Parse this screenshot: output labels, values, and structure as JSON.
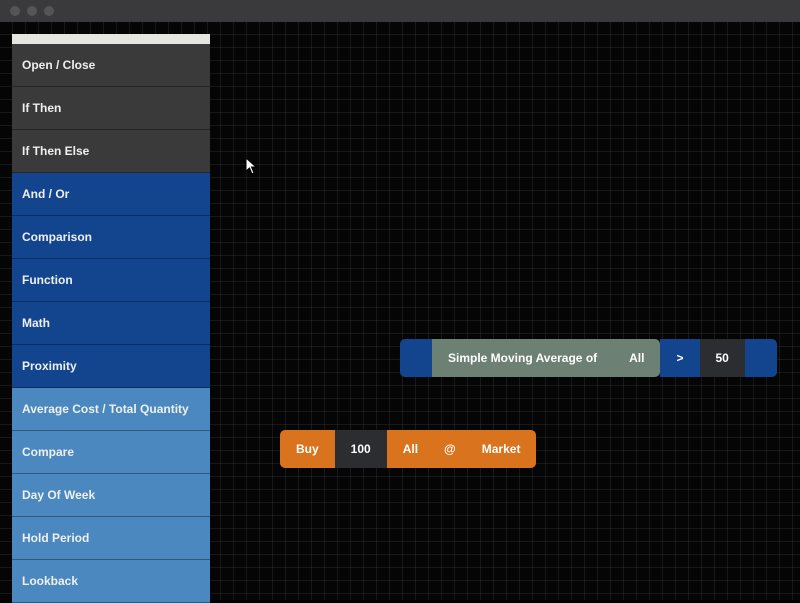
{
  "sidebar": {
    "groups": [
      {
        "tone": "dark",
        "items": [
          "Open / Close",
          "If Then",
          "If Then Else"
        ]
      },
      {
        "tone": "blue",
        "items": [
          "And / Or",
          "Comparison",
          "Function",
          "Math",
          "Proximity"
        ]
      },
      {
        "tone": "lightblue",
        "items": [
          "Average Cost / Total Quantity",
          "Compare",
          "Day Of Week",
          "Hold Period",
          "Lookback"
        ]
      }
    ]
  },
  "canvas": {
    "comparison_node": {
      "function_label": "Simple Moving Average of",
      "scope": "All",
      "operator": ">",
      "value": "50"
    },
    "action_node": {
      "action": "Buy",
      "quantity": "100",
      "target": "All",
      "at_symbol": "@",
      "order_type": "Market"
    }
  }
}
